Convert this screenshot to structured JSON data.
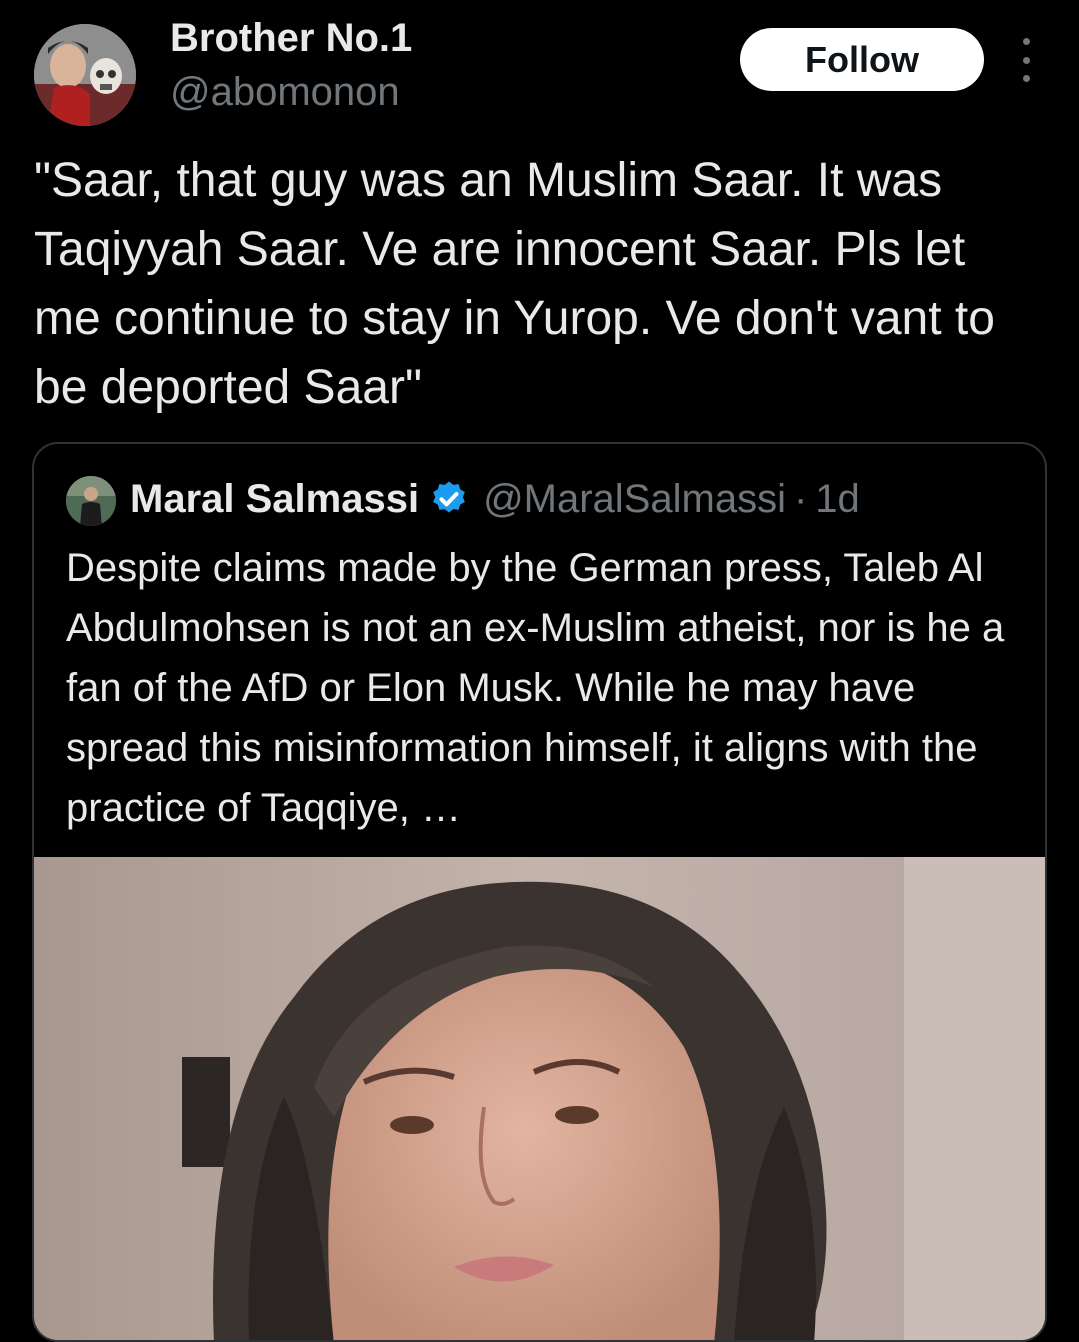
{
  "tweet": {
    "author_name": "Brother No.1",
    "author_handle": "@abomonon",
    "follow_label": "Follow",
    "text": "\"Saar, that guy was an Muslim Saar. It was Taqiyyah Saar. Ve are innocent Saar. Pls let me continue to stay in Yurop. Ve don't vant to be deported Saar\""
  },
  "quote": {
    "author_name": "Maral Salmassi",
    "verified": true,
    "author_handle": "@MaralSalmassi",
    "separator": "·",
    "time": "1d",
    "text": "Despite claims made by the German press, Taleb Al Abdulmohsen is not an ex-Muslim atheist, nor is he a fan of the AfD or Elon Musk. While he may have spread this misinformation himself, it aligns with the practice of Taqqiye, …"
  },
  "icons": {
    "more": "more-options-icon",
    "verified": "verified-badge-icon"
  },
  "colors": {
    "background": "#000000",
    "text_primary": "#e7e9ea",
    "text_secondary": "#71767b",
    "border": "#2f3336",
    "verified": "#1d9bf0",
    "follow_bg": "#ffffff",
    "follow_text": "#0f1419"
  }
}
